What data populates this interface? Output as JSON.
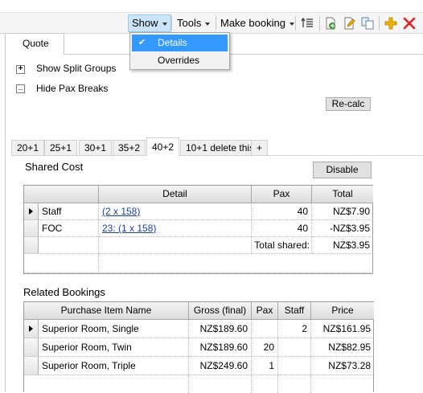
{
  "toolbar": {
    "show_label": "Show",
    "tools_label": "Tools",
    "make_booking_label": "Make booking",
    "icons": [
      "reorder-icon",
      "export-icon",
      "edit-icon",
      "copy-icon",
      "add-icon",
      "delete-icon"
    ]
  },
  "show_menu": {
    "items": [
      {
        "label": "Details",
        "checked": true
      },
      {
        "label": "Overrides",
        "checked": false
      }
    ]
  },
  "main_tab": {
    "label": "Quote"
  },
  "options": {
    "split_groups": {
      "symbol": "+",
      "label": "Show Split Groups"
    },
    "pax_breaks": {
      "symbol": "_",
      "label": "Hide Pax Breaks"
    },
    "recalc_label": "Re-calc"
  },
  "pax_tabs": [
    "20+1",
    "25+1",
    "30+1",
    "35+2",
    "40+2",
    "10+1 delete this",
    "+"
  ],
  "active_pax_tab": "40+2",
  "shared_cost": {
    "title": "Shared Cost",
    "disable_label": "Disable",
    "columns": [
      "",
      "Detail",
      "Pax",
      "Total"
    ],
    "rows": [
      {
        "name": "Staff",
        "detail": "(2 x 158)",
        "pax": "40",
        "total": "NZ$7.90"
      },
      {
        "name": "FOC",
        "detail": "23: (1 x 158)",
        "pax": "40",
        "total": "-NZ$3.95"
      }
    ],
    "total_label": "Total shared:",
    "total_value": "NZ$3.95"
  },
  "related_bookings": {
    "title": "Related Bookings",
    "columns": [
      "Purchase Item Name",
      "Gross (final)",
      "Pax",
      "Staff",
      "Price"
    ],
    "rows": [
      {
        "name": "Superior Room, Single",
        "gross": "NZ$189.60",
        "pax": "",
        "staff": "2",
        "price": "NZ$161.95"
      },
      {
        "name": "Superior Room, Twin",
        "gross": "NZ$189.60",
        "pax": "20",
        "staff": "",
        "price": "NZ$82.95"
      },
      {
        "name": "Superior Room, Triple",
        "gross": "NZ$249.60",
        "pax": "1",
        "staff": "",
        "price": "NZ$73.28"
      }
    ]
  },
  "colors": {
    "menu_highlight": "#3399ff",
    "pressed_button": "#cce4f7",
    "link": "#1a3fa8",
    "delete_icon": "#e02020",
    "add_icon": "#f0b400"
  }
}
